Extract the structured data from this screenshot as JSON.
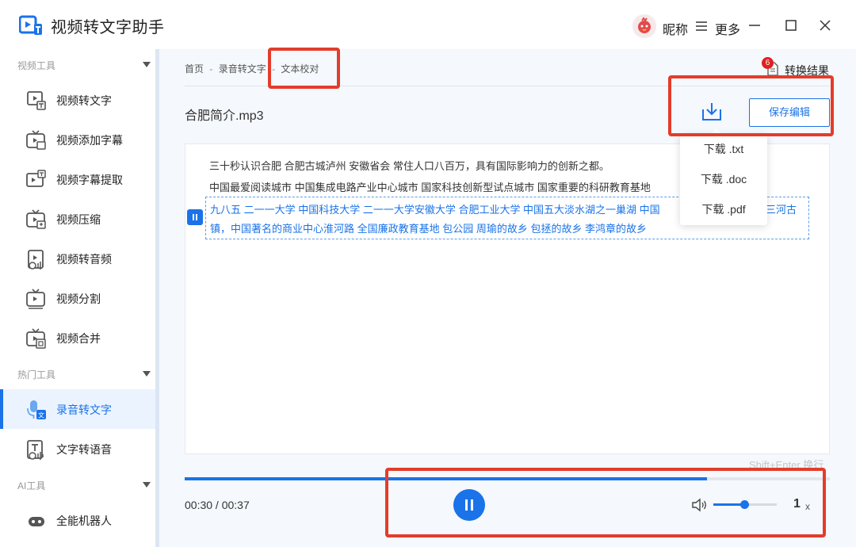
{
  "app": {
    "title": "视频转文字助手",
    "nickname": "昵称",
    "more": "更多"
  },
  "sidebar": {
    "sections": [
      {
        "title": "视频工具",
        "items": [
          "视频转文字",
          "视频添加字幕",
          "视频字幕提取",
          "视频压缩",
          "视频转音频",
          "视频分割",
          "视频合并"
        ]
      },
      {
        "title": "热门工具",
        "items": [
          "录音转文字",
          "文字转语音"
        ]
      },
      {
        "title": "AI工具",
        "items": [
          "全能机器人"
        ]
      }
    ],
    "active_item": "录音转文字"
  },
  "breadcrumb": [
    "首页",
    "-",
    "录音转文字",
    "-",
    "文本校对"
  ],
  "result": {
    "badge": "6",
    "label": "转换结果"
  },
  "file": {
    "name": "合肥简介.mp3"
  },
  "toolbar": {
    "save_label": "保存编辑"
  },
  "download_menu": [
    "下载 .txt",
    "下载 .doc",
    "下载 .pdf"
  ],
  "transcript": {
    "line1": "三十秒认识合肥 合肥古城泸州 安徽省会 常住人口八百万，具有国际影响力的创新之都。",
    "line2": "中国最爱阅读城市 中国集成电路产业中心城市 国家科技创新型试点城市 国家重要的科研教育基地",
    "active_line1": "九八五 二一一大学 中国科技大学 二一一大学安徽大学 合肥工业大学 中国五大淡水湖之一巢湖 中国",
    "active_line1_tail": "三河古",
    "active_line2": "镇，中国著名的商业中心淮河路 全国廉政教育基地 包公园 周瑜的故乡 包拯的故乡 李鸿章的故乡"
  },
  "hint": "Shift+Enter 换行",
  "player": {
    "time": "00:30 / 00:37",
    "progress": 0.81,
    "volume": 0.5,
    "speed": "1",
    "speed_unit": "x"
  },
  "colors": {
    "accent": "#1a73e8",
    "annotation": "#e43c2b"
  }
}
